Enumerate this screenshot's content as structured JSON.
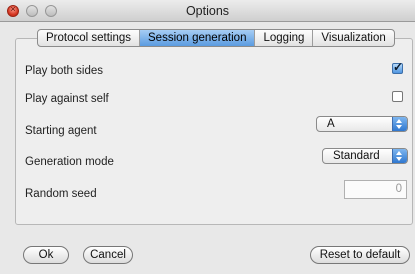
{
  "window": {
    "title": "Options"
  },
  "tabs": [
    {
      "label": "Protocol settings",
      "active": false
    },
    {
      "label": "Session generation",
      "active": true
    },
    {
      "label": "Logging",
      "active": false
    },
    {
      "label": "Visualization",
      "active": false
    }
  ],
  "settings": {
    "play_both_sides": {
      "label": "Play both sides",
      "checked": true
    },
    "play_against_self": {
      "label": "Play against self",
      "checked": false
    },
    "starting_agent": {
      "label": "Starting agent",
      "value": "A"
    },
    "generation_mode": {
      "label": "Generation mode",
      "value": "Standard"
    },
    "random_seed": {
      "label": "Random seed",
      "value": "0"
    }
  },
  "buttons": {
    "ok": "Ok",
    "cancel": "Cancel",
    "reset": "Reset to default"
  },
  "icons": {
    "close": "close-icon",
    "checkmark": "checkmark-icon",
    "stepper": "stepper-arrows-icon"
  },
  "colors": {
    "accent": "#5b9be0",
    "close_light": "#d2321e"
  }
}
